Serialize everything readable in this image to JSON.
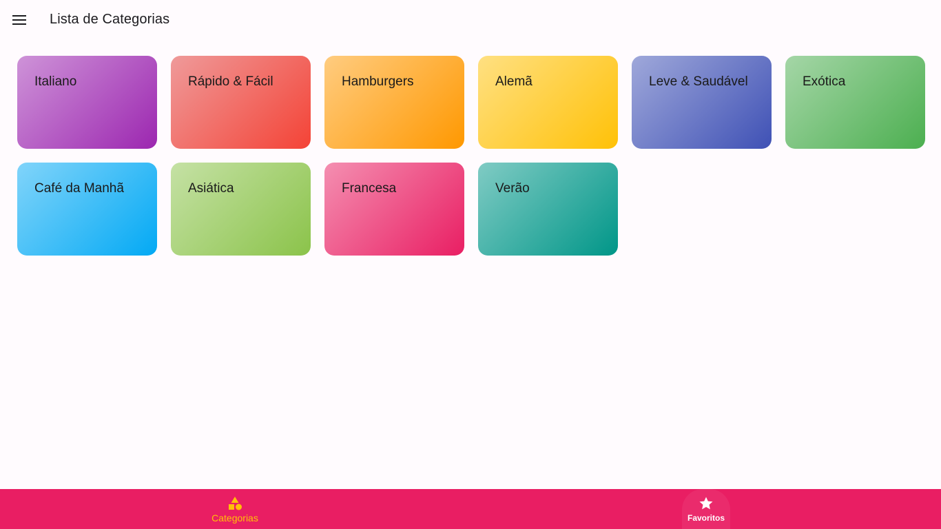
{
  "appbar": {
    "title": "Lista de Categorias",
    "menu_icon": "menu-icon"
  },
  "categories": [
    {
      "label": "Italiano",
      "color_from": "#ce93d8",
      "color_to": "#9c27b0"
    },
    {
      "label": "Rápido & Fácil",
      "color_from": "#ef9a9a",
      "color_to": "#f44336"
    },
    {
      "label": "Hamburgers",
      "color_from": "#ffcc80",
      "color_to": "#ff9800"
    },
    {
      "label": "Alemã",
      "color_from": "#ffe082",
      "color_to": "#ffc107"
    },
    {
      "label": "Leve & Saudável",
      "color_from": "#9fa8da",
      "color_to": "#3f51b5"
    },
    {
      "label": "Exótica",
      "color_from": "#a5d6a7",
      "color_to": "#4caf50"
    },
    {
      "label": "Café da Manhã",
      "color_from": "#81d4fa",
      "color_to": "#03a9f4"
    },
    {
      "label": "Asiática",
      "color_from": "#c5e1a5",
      "color_to": "#8bc34a"
    },
    {
      "label": "Francesa",
      "color_from": "#f48fb1",
      "color_to": "#e91e63"
    },
    {
      "label": "Verão",
      "color_from": "#80cbc4",
      "color_to": "#009688"
    }
  ],
  "bottom_nav": {
    "background": "#e91e63",
    "selected_color": "#ffc107",
    "items": [
      {
        "label": "Categorias",
        "icon": "category-icon",
        "selected": true
      },
      {
        "label": "Favoritos",
        "icon": "star-icon",
        "selected": false
      }
    ]
  }
}
